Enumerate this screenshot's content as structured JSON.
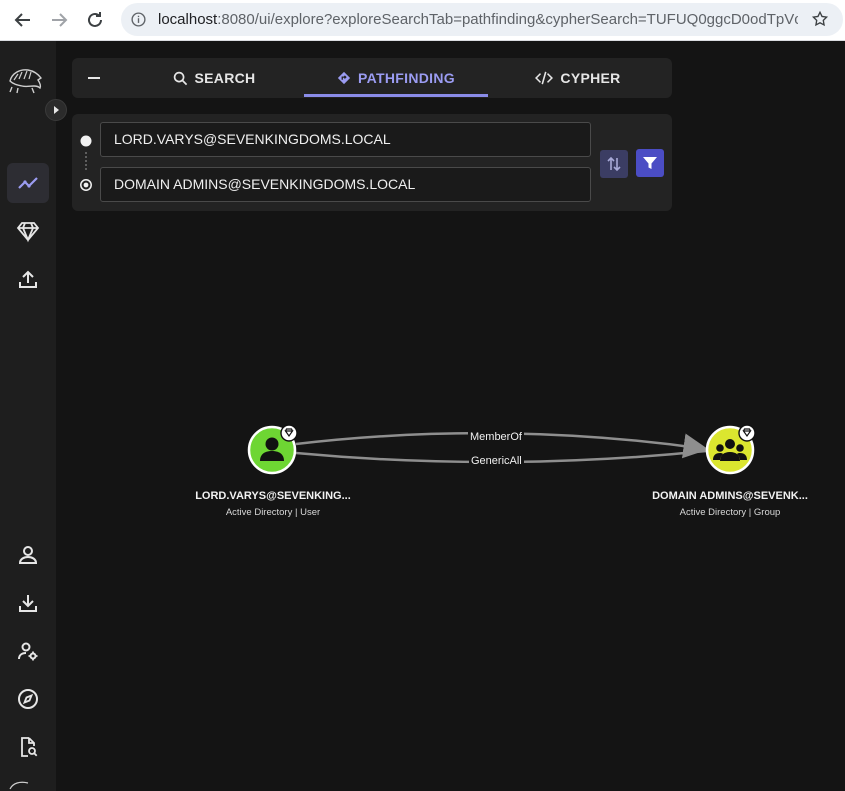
{
  "browser": {
    "url_host": "localhost",
    "url_rest": ":8080/ui/explore?exploreSearchTab=pathfinding&cypherSearch=TUFUQ0ggcD0odTpVc2V..."
  },
  "tabs": [
    {
      "label": "SEARCH",
      "icon": "search-icon"
    },
    {
      "label": "PATHFINDING",
      "icon": "diamond-route-icon",
      "active": true
    },
    {
      "label": "CYPHER",
      "icon": "code-icon"
    }
  ],
  "pathfinding": {
    "start": "LORD.VARYS@SEVENKINGDOMS.LOCAL",
    "end": "DOMAIN ADMINS@SEVENKINGDOMS.LOCAL"
  },
  "graph": {
    "nodes": [
      {
        "label": "LORD.VARYS@SEVENKING...",
        "sub": "Active Directory | User",
        "color": "#6ed633",
        "kind": "user"
      },
      {
        "label": "DOMAIN ADMINS@SEVENK...",
        "sub": "Active Directory | Group",
        "color": "#dbe62f",
        "kind": "group"
      }
    ],
    "edges": [
      "MemberOf",
      "GenericAll"
    ]
  },
  "colors": {
    "accent": "#8a8ce8",
    "user_node": "#6ed633",
    "group_node": "#dbe62f"
  }
}
